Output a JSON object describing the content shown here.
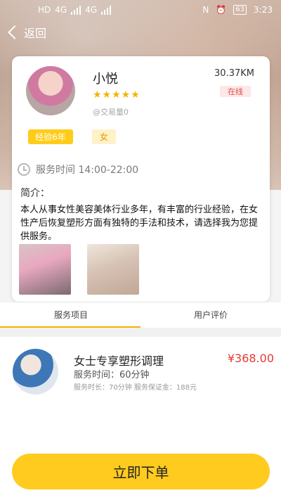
{
  "status_bar": {
    "left_labels": [
      "HD",
      "4G",
      "4G"
    ],
    "battery": "63",
    "time": "3:23"
  },
  "nav": {
    "back_label": "返回"
  },
  "profile": {
    "name": "小悦",
    "rating_stars": "★★★★★",
    "trade_text": "@交易量0",
    "distance": "30.37KM",
    "status": "在线",
    "experience": "经验6年",
    "gender": "女",
    "service_time": "服务时间 14:00-22:00",
    "intro_title": "简介：",
    "intro_text": "本人从事女性美容美体行业多年，有丰富的行业经验，在女性产后恢复塑形方面有独特的手法和技术，请选择我为您提供服务。"
  },
  "tabs": {
    "services": "服务项目",
    "reviews": "用户评价"
  },
  "service_item": {
    "title": "女士专享塑形调理",
    "duration": "服务时间：60分钟",
    "meta": "服务时长：70分钟 服务保证金：188元",
    "price": "¥368.00"
  },
  "cta": {
    "order": "立即下单"
  },
  "colors": {
    "accent": "#ffcb1f",
    "price": "#e53935",
    "online": "#e34d4d"
  }
}
